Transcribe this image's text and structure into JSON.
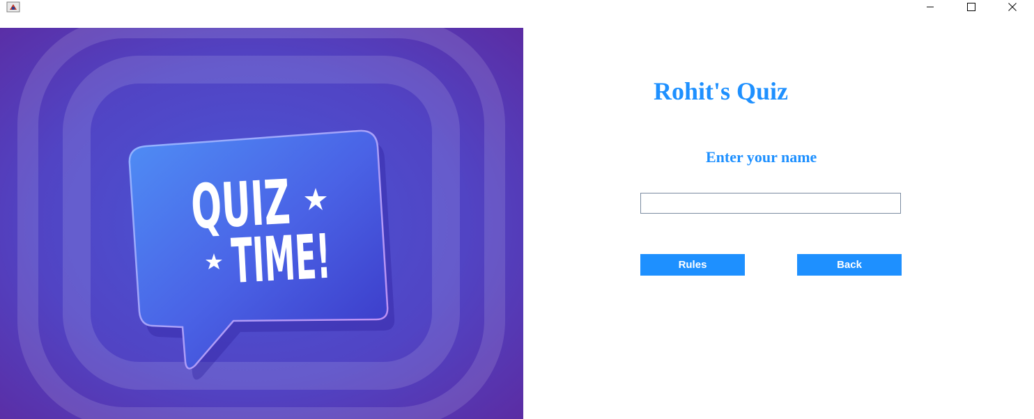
{
  "titlebar": {
    "icon": "java-app-icon",
    "controls": [
      "minimize-icon",
      "maximize-icon",
      "close-icon"
    ]
  },
  "hero": {
    "line1": "QUIZ",
    "line2": "TIME!",
    "colors": {
      "bg": "#5a3fc0",
      "bubble": "#4a5fe0",
      "text": "#ffffff"
    }
  },
  "main": {
    "title": "Rohit's Quiz",
    "name_label": "Enter your name",
    "name_value": "",
    "rules_label": "Rules",
    "back_label": "Back"
  },
  "colors": {
    "accent": "#1e90ff",
    "button_text": "#ffffff"
  }
}
